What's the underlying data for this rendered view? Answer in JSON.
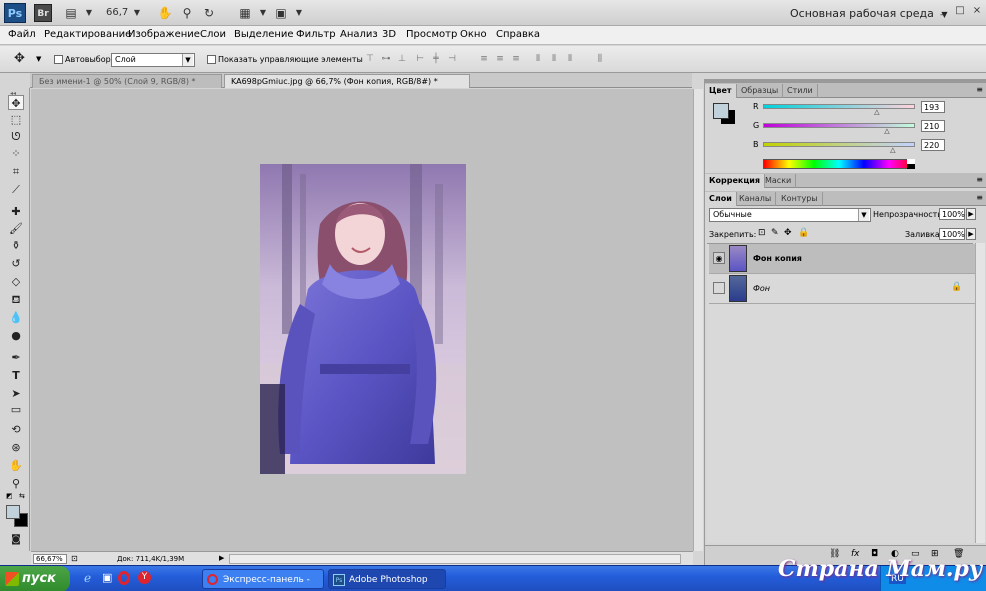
{
  "app": {
    "logo": "Ps",
    "bridge": "Br",
    "zoom": "66,7",
    "workspace": "Основная рабочая среда",
    "workspace_arrow": "▼",
    "window_buttons": [
      "_",
      "□",
      "×"
    ]
  },
  "menu": [
    "Файл",
    "Редактирование",
    "Изображение",
    "Слои",
    "Выделение",
    "Фильтр",
    "Анализ",
    "3D",
    "Просмотр",
    "Окно",
    "Справка"
  ],
  "options_bar": {
    "autoselect_label": "Автовыбор:",
    "autoselect_value": "Слой",
    "show_controls_label": "Показать управляющие элементы"
  },
  "tabs": [
    {
      "label": "Без имени-1 @ 50% (Слой 9, RGB/8) *",
      "active": false
    },
    {
      "label": "KA698pGmiuc.jpg @ 66,7% (Фон копия, RGB/8#) *",
      "active": true
    }
  ],
  "status": {
    "zoom": "66,67%",
    "doc": "Док: 711,4K/1,39M"
  },
  "color_panel": {
    "tabs": [
      "Цвет",
      "Образцы",
      "Стили"
    ],
    "channels": [
      {
        "label": "R",
        "value": "193",
        "level": 0.757
      },
      {
        "label": "G",
        "value": "210",
        "level": 0.824
      },
      {
        "label": "B",
        "value": "220",
        "level": 0.863
      }
    ],
    "foreground": "#c1d2dc"
  },
  "adjust_panel": {
    "tabs": [
      "Коррекция",
      "Маски"
    ]
  },
  "layers_panel": {
    "tabs": [
      "Слои",
      "Каналы",
      "Контуры"
    ],
    "blend_mode": "Обычные",
    "opacity_label": "Непрозрачность:",
    "opacity": "100%",
    "lock_label": "Закрепить:",
    "fill_label": "Заливка:",
    "fill": "100%",
    "layers": [
      {
        "name": "Фон копия",
        "visible": true,
        "selected": true,
        "locked": false
      },
      {
        "name": "Фон",
        "visible": false,
        "selected": false,
        "locked": true
      }
    ]
  },
  "taskbar": {
    "start": "пуск",
    "items": [
      {
        "label": "Экспресс-панель - О...",
        "active": false
      },
      {
        "label": "Adobe Photoshop CS...",
        "active": true
      }
    ],
    "tray_lang": "RU"
  },
  "watermark": "Страна Мам.ру"
}
